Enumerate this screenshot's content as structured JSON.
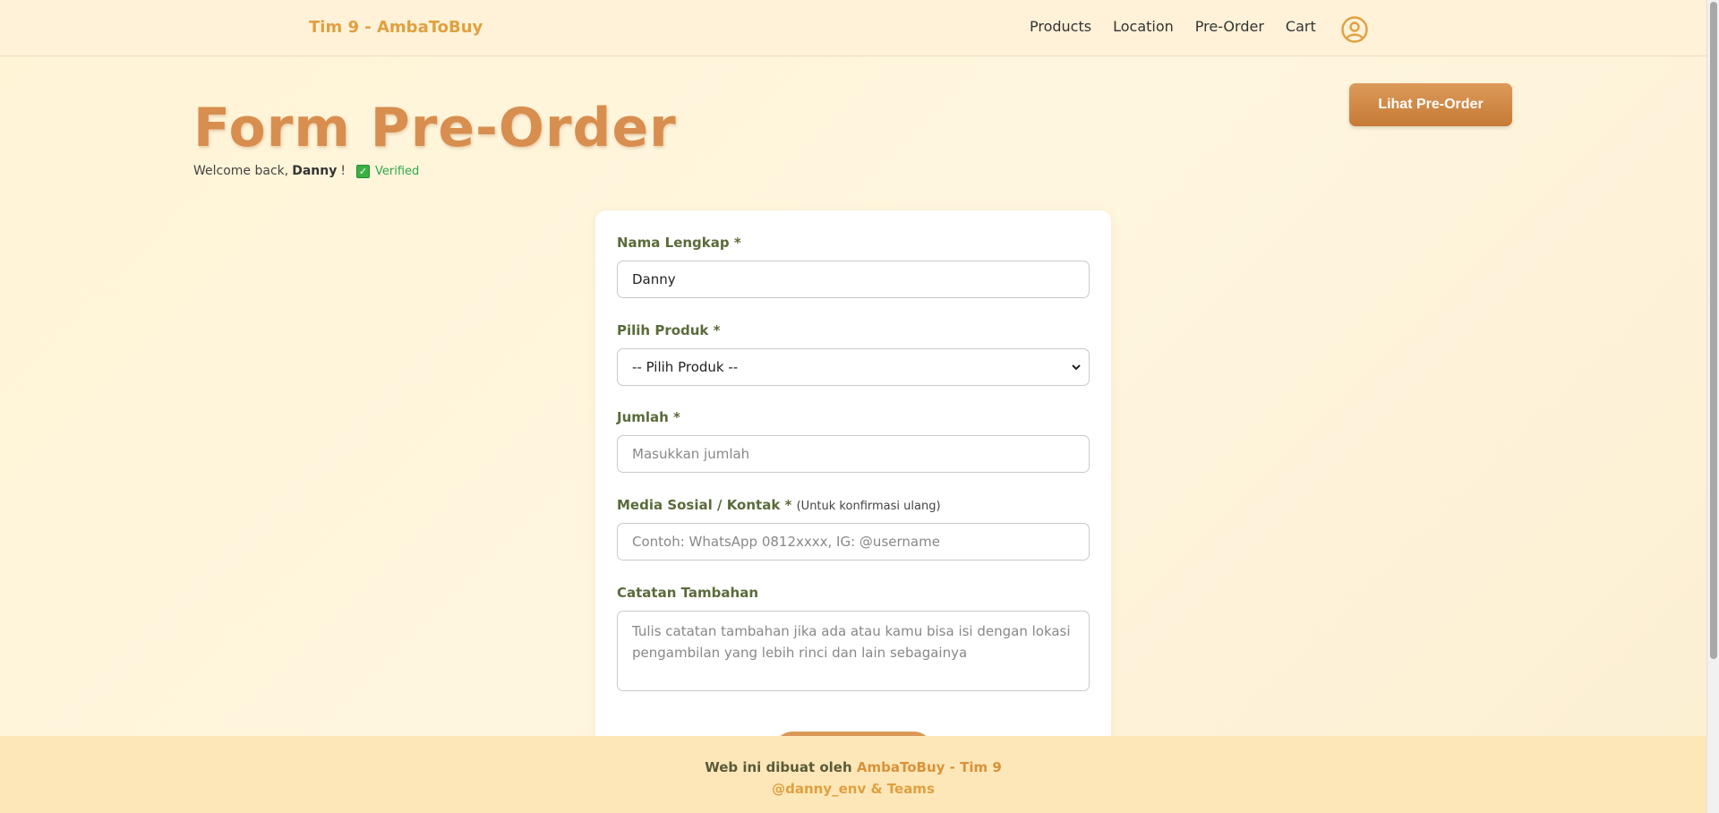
{
  "header": {
    "brand": "Tim 9 - AmbaToBuy",
    "nav": [
      "Products",
      "Location",
      "Pre-Order",
      "Cart"
    ],
    "profile_icon": "user-circle-icon"
  },
  "page": {
    "title": "Form Pre-Order",
    "welcome_prefix": "Welcome back,",
    "user_name": "Danny",
    "welcome_suffix": "!",
    "verified_label": "Verified",
    "lihat_button": "Lihat Pre-Order"
  },
  "form": {
    "nama": {
      "label": "Nama Lengkap *",
      "value": "Danny"
    },
    "produk": {
      "label": "Pilih Produk *",
      "selected": "-- Pilih Produk --"
    },
    "jumlah": {
      "label": "Jumlah *",
      "placeholder": "Masukkan jumlah"
    },
    "kontak": {
      "label": "Media Sosial / Kontak *",
      "note": "(Untuk konfirmasi ulang)",
      "placeholder": "Contoh: WhatsApp 0812xxxx, IG: @username"
    },
    "catatan": {
      "label": "Catatan Tambahan",
      "placeholder": "Tulis catatan tambahan jika ada atau kamu bisa isi dengan lokasi pengambilan yang lebih rinci dan lain sebagainya"
    }
  },
  "footer": {
    "prefix": "Web ini dibuat oleh",
    "brand": "AmbaToBuy - Tim 9",
    "credit": "@danny_env & Teams"
  },
  "colors": {
    "accent": "#d88e4f",
    "button": "#c67a36",
    "label": "#5a6b3a",
    "verified": "#2ea84a"
  }
}
